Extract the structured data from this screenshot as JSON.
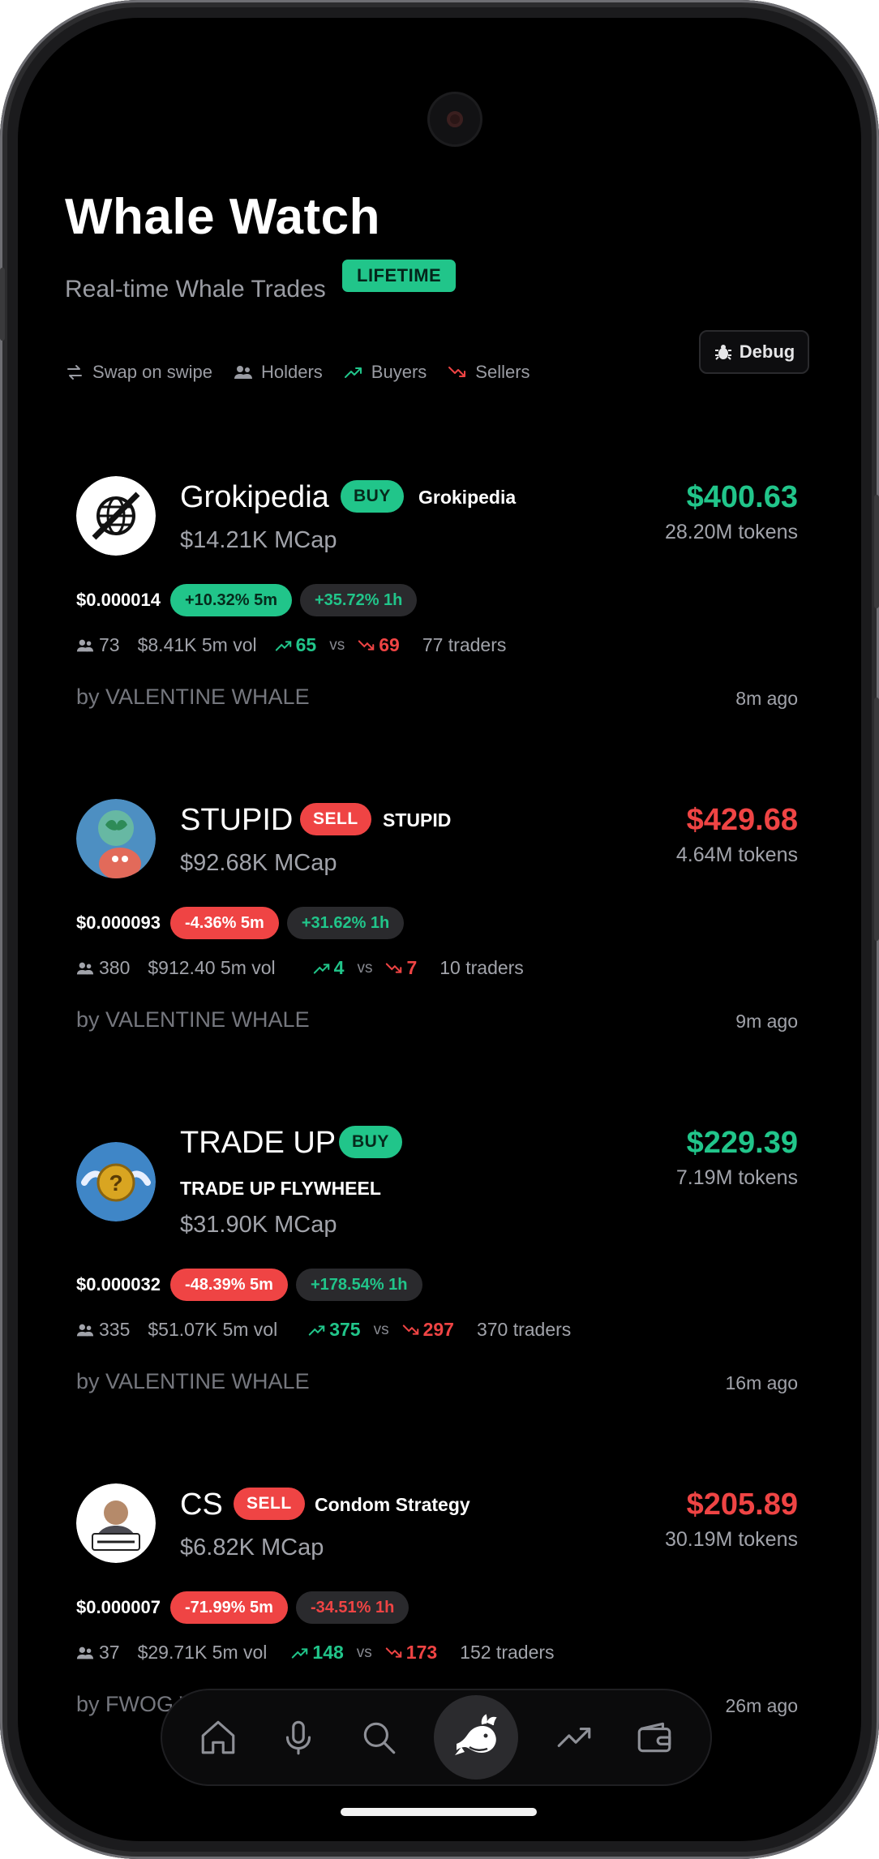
{
  "app": {
    "title": "Whale Watch",
    "subtitle": "Real-time Whale Trades",
    "range_badge": "LIFETIME"
  },
  "filters": [
    {
      "label": "Swap on swipe",
      "icon": "swap-icon"
    },
    {
      "label": "Holders",
      "icon": "users-icon"
    },
    {
      "label": "Buyers",
      "icon": "trend-up-icon"
    },
    {
      "label": "Sellers",
      "icon": "trend-down-icon"
    }
  ],
  "debug_label": "Debug",
  "trades": [
    {
      "name": "Grokipedia",
      "side": "BUY",
      "ticker": "Grokipedia",
      "mcap": "$14.21K MCap",
      "usd": "$400.63",
      "tokens": "28.20M tokens",
      "price": "$0.000014",
      "change5m": "+10.32% 5m",
      "change1h": "+35.72% 1h",
      "holders": "73",
      "vol": "$8.41K 5m vol",
      "buyers": "65",
      "vs": "vs",
      "sellers": "69",
      "traders": "77 traders",
      "by": "by VALENTINE WHALE",
      "ago": "8m ago"
    },
    {
      "name": "STUPID",
      "side": "SELL",
      "ticker": "STUPID",
      "mcap": "$92.68K MCap",
      "usd": "$429.68",
      "tokens": "4.64M tokens",
      "price": "$0.000093",
      "change5m": "-4.36% 5m",
      "change1h": "+31.62% 1h",
      "holders": "380",
      "vol": "$912.40 5m vol",
      "buyers": "4",
      "vs": "vs",
      "sellers": "7",
      "traders": "10 traders",
      "by": "by VALENTINE WHALE",
      "ago": "9m ago"
    },
    {
      "name": "TRADE UP",
      "side": "BUY",
      "ticker": "TRADE UP FLYWHEEL",
      "mcap": "$31.90K MCap",
      "usd": "$229.39",
      "tokens": "7.19M tokens",
      "price": "$0.000032",
      "change5m": "-48.39% 5m",
      "change1h": "+178.54% 1h",
      "holders": "335",
      "vol": "$51.07K 5m vol",
      "buyers": "375",
      "vs": "vs",
      "sellers": "297",
      "traders": "370 traders",
      "by": "by VALENTINE WHALE",
      "ago": "16m ago"
    },
    {
      "name": "CS",
      "side": "SELL",
      "ticker": "Condom Strategy",
      "mcap": "$6.82K MCap",
      "usd": "$205.89",
      "tokens": "30.19M tokens",
      "price": "$0.000007",
      "change5m": "-71.99% 5m",
      "change1h": "-34.51% 1h",
      "holders": "37",
      "vol": "$29.71K 5m vol",
      "buyers": "148",
      "vs": "vs",
      "sellers": "173",
      "traders": "152 traders",
      "by": "by FWOG WHALE",
      "ago": "26m ago"
    }
  ],
  "nav": [
    {
      "icon": "home-icon",
      "active": false
    },
    {
      "icon": "microphone-icon",
      "active": false
    },
    {
      "icon": "search-icon",
      "active": false
    },
    {
      "icon": "whale-icon",
      "active": true
    },
    {
      "icon": "trending-icon",
      "active": false
    },
    {
      "icon": "wallet-icon",
      "active": false
    }
  ],
  "colors": {
    "green": "#21c58a",
    "red": "#ef4444",
    "muted": "#a1a3aa",
    "background": "#000000"
  }
}
